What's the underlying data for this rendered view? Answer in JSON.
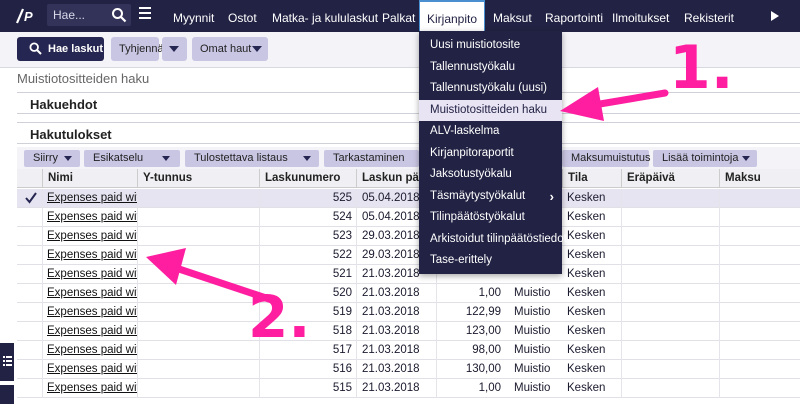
{
  "search": {
    "placeholder": "Hae..."
  },
  "nav": [
    {
      "label": "Myynnit"
    },
    {
      "label": "Ostot"
    },
    {
      "label": "Matka- ja kululaskut"
    },
    {
      "label": "Palkat"
    },
    {
      "label": "Kirjanpito"
    },
    {
      "label": "Maksut"
    },
    {
      "label": "Raportointi"
    },
    {
      "label": "Ilmoitukset"
    },
    {
      "label": "Rekisterit"
    }
  ],
  "toolbar": {
    "search_btn": "Hae laskut",
    "clear_btn": "Tyhjennä",
    "saved_btn": "Omat haut"
  },
  "page_title": "Muistiotositteiden haku",
  "criteria_title": "Hakuehdot",
  "results_title": "Hakutulokset",
  "result_actions": {
    "move": "Siirry",
    "preview": "Esikatselu",
    "printable": "Tulostettava listaus",
    "check": "Tarkastaminen",
    "payment": "Maksumuistutus",
    "more": "Lisää toimintoja"
  },
  "columns": {
    "name": "Nimi",
    "ytunnus": "Y-tunnus",
    "invoice_no": "Laskunumero",
    "date": "Laskun päiv",
    "status": "Tila",
    "due": "Eräpäivä",
    "paid": "Maksu"
  },
  "rows": [
    {
      "name": "Expenses paid with",
      "number": "525",
      "date": "05.04.2018",
      "amount": "",
      "type": "",
      "status": "Kesken",
      "selected": true
    },
    {
      "name": "Expenses paid with",
      "number": "524",
      "date": "05.04.2018",
      "amount": "",
      "type": "",
      "status": "Kesken"
    },
    {
      "name": "Expenses paid with",
      "number": "523",
      "date": "29.03.2018",
      "amount": "",
      "type": "",
      "status": "Kesken"
    },
    {
      "name": "Expenses paid with",
      "number": "522",
      "date": "29.03.2018",
      "amount": "",
      "type": "",
      "status": "Kesken"
    },
    {
      "name": "Expenses paid with",
      "number": "521",
      "date": "21.03.2018",
      "amount": "",
      "type": "",
      "status": "Kesken"
    },
    {
      "name": "Expenses paid with",
      "number": "520",
      "date": "21.03.2018",
      "amount": "1,00",
      "type": "Muistio",
      "status": "Kesken"
    },
    {
      "name": "Expenses paid with",
      "number": "519",
      "date": "21.03.2018",
      "amount": "122,99",
      "type": "Muistio",
      "status": "Kesken"
    },
    {
      "name": "Expenses paid with",
      "number": "518",
      "date": "21.03.2018",
      "amount": "123,00",
      "type": "Muistio",
      "status": "Kesken"
    },
    {
      "name": "Expenses paid with",
      "number": "517",
      "date": "21.03.2018",
      "amount": "98,00",
      "type": "Muistio",
      "status": "Kesken"
    },
    {
      "name": "Expenses paid with",
      "number": "516",
      "date": "21.03.2018",
      "amount": "130,00",
      "type": "Muistio",
      "status": "Kesken"
    },
    {
      "name": "Expenses paid with",
      "number": "515",
      "date": "21.03.2018",
      "amount": "1,00",
      "type": "Muistio",
      "status": "Kesken"
    }
  ],
  "dropdown": [
    {
      "label": "Uusi muistiotosite"
    },
    {
      "label": "Tallennustyökalu"
    },
    {
      "label": "Tallennustyökalu (uusi)"
    },
    {
      "label": "Muistiotositteiden haku",
      "highlighted": true
    },
    {
      "label": "ALV-laskelma"
    },
    {
      "label": "Kirjanpitoraportit"
    },
    {
      "label": "Jaksotustyökalu"
    },
    {
      "label": "Täsmäytystyökalut",
      "submenu": true
    },
    {
      "label": "Tilinpäätöstyökalut"
    },
    {
      "label": "Arkistoidut tilinpäätöstiedot"
    },
    {
      "label": "Tase-erittely"
    }
  ],
  "annotations": {
    "one": "1.",
    "two": "2."
  },
  "colors": {
    "nav_bg": "#222244",
    "button_lavender": "#c9c6e4",
    "annotation": "#ff1ea0",
    "highlight": "#e8e4f4"
  }
}
